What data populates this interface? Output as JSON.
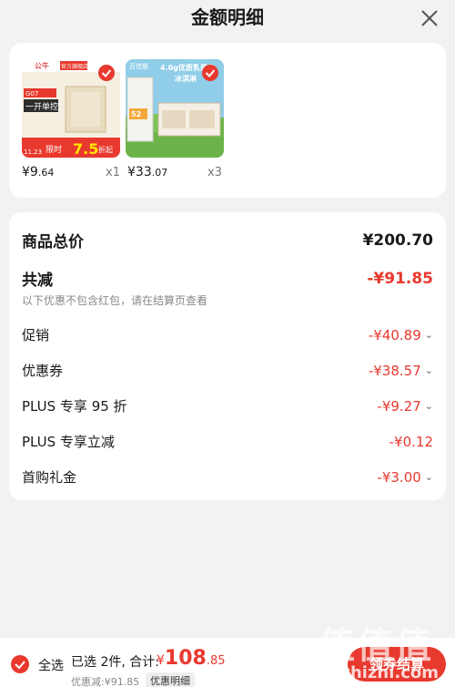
{
  "header": {
    "title": "金额明细"
  },
  "products": [
    {
      "price_main": "¥9",
      "price_cents": ".64",
      "qty": "x1",
      "banner": "官方旗舰店",
      "brand": "公牛",
      "model": "G07",
      "name": "一开单控",
      "sale": "限时",
      "discount": "7.5",
      "discount_unit": "折起",
      "date": "11.23"
    },
    {
      "price_main": "¥33",
      "price_cents": ".07",
      "qty": "x3",
      "brand": "百佳酪",
      "tagline": "4.0g优质乳蛋白",
      "subline": "冰淇淋",
      "badge": "52"
    }
  ],
  "summary": {
    "goods_total": {
      "label": "商品总价",
      "value": "¥200.70"
    },
    "total_reduce": {
      "label": "共减",
      "value": "-¥91.85"
    },
    "note": "以下优惠不包含红包，请在结算页查看",
    "items": [
      {
        "label": "促销",
        "value": "-¥40.89"
      },
      {
        "label": "优惠券",
        "value": "-¥38.57"
      },
      {
        "label": "PLUS 专享 95 折",
        "value": "-¥9.27"
      },
      {
        "label": "PLUS 专享立减",
        "value": "-¥0.12"
      },
      {
        "label": "首购礼金",
        "value": "-¥3.00"
      }
    ]
  },
  "footer": {
    "select_all": "全选",
    "chosen": "已选 2件, 合计:",
    "total_yen": "¥",
    "total_main": "108",
    "total_cents": ".85",
    "discount": "优惠减:¥91.85",
    "detail_btn": "优惠明细",
    "coupon_btn": "领券结算"
  },
  "watermark": {
    "text": "值值值",
    "url": "zhizhizhi.com"
  },
  "colors": {
    "accent": "#e8392e",
    "background": "#f2f2f2"
  }
}
